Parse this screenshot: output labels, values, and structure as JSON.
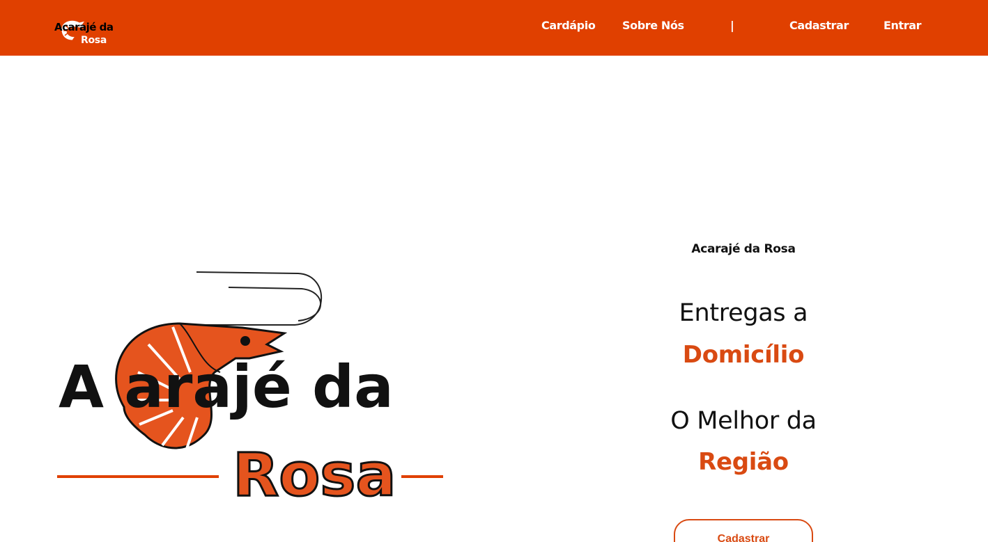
{
  "brand": {
    "logo_line1": "Acarajé da",
    "logo_line2": "Rosa",
    "logo_icon": "shrimp-icon"
  },
  "nav": {
    "items": [
      "Cardápio",
      "Sobre Nós",
      "|",
      "Cadastrar",
      "Entrar"
    ]
  },
  "hero_logo": {
    "line1": "A  arajé da",
    "line2": "Rosa"
  },
  "hero": {
    "small_title": "Acarajé da Rosa",
    "line1": "Entregas a",
    "line1_accent": "Domicílio",
    "line2": "O Melhor da",
    "line2_accent": "Região",
    "cta_label": "Cadastrar"
  },
  "colors": {
    "header_bg": "#E04000",
    "accent": "#D94A12",
    "text": "#111111"
  }
}
